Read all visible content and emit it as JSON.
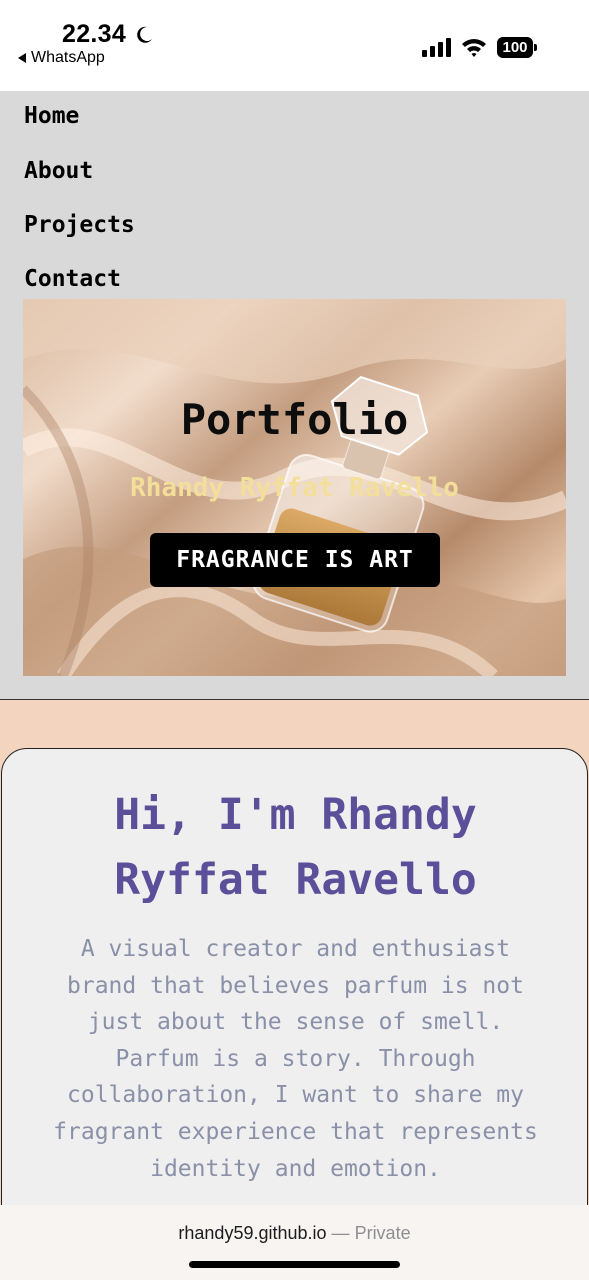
{
  "status_bar": {
    "time": "22.34",
    "back_app": "WhatsApp",
    "battery": "100",
    "icons": [
      "moon-icon",
      "back-arrow-icon",
      "signal-icon",
      "wifi-icon",
      "battery-icon"
    ]
  },
  "nav": {
    "items": [
      {
        "label": "Home"
      },
      {
        "label": "About"
      },
      {
        "label": "Projects"
      },
      {
        "label": "Contact"
      }
    ]
  },
  "hero": {
    "title": "Portfolio",
    "name": "Rhandy Ryffat Ravello",
    "tagline": "FRAGRANCE IS ART",
    "image": "perfume-bottle-on-satin"
  },
  "intro": {
    "heading_line1": "Hi, I'm Rhandy",
    "heading_line2": "Ryffat Ravello",
    "paragraph_lines": [
      "A visual creator and enthusiast",
      "brand that believes parfum is not",
      "just about the sense of smell.",
      "Parfum is a story. Through",
      "collaboration, I want to share my",
      "fragrant experience that represents",
      "identity and emotion."
    ]
  },
  "browser": {
    "domain": "rhandy59.github.io",
    "separator": "—",
    "privacy": "Private"
  },
  "colors": {
    "page_background": "#f3d5bf",
    "nav_background": "#d9d9d9",
    "heading_purple": "#5c4f99",
    "name_gold": "#f4df9a",
    "body_text_gray": "#8a90a8"
  }
}
